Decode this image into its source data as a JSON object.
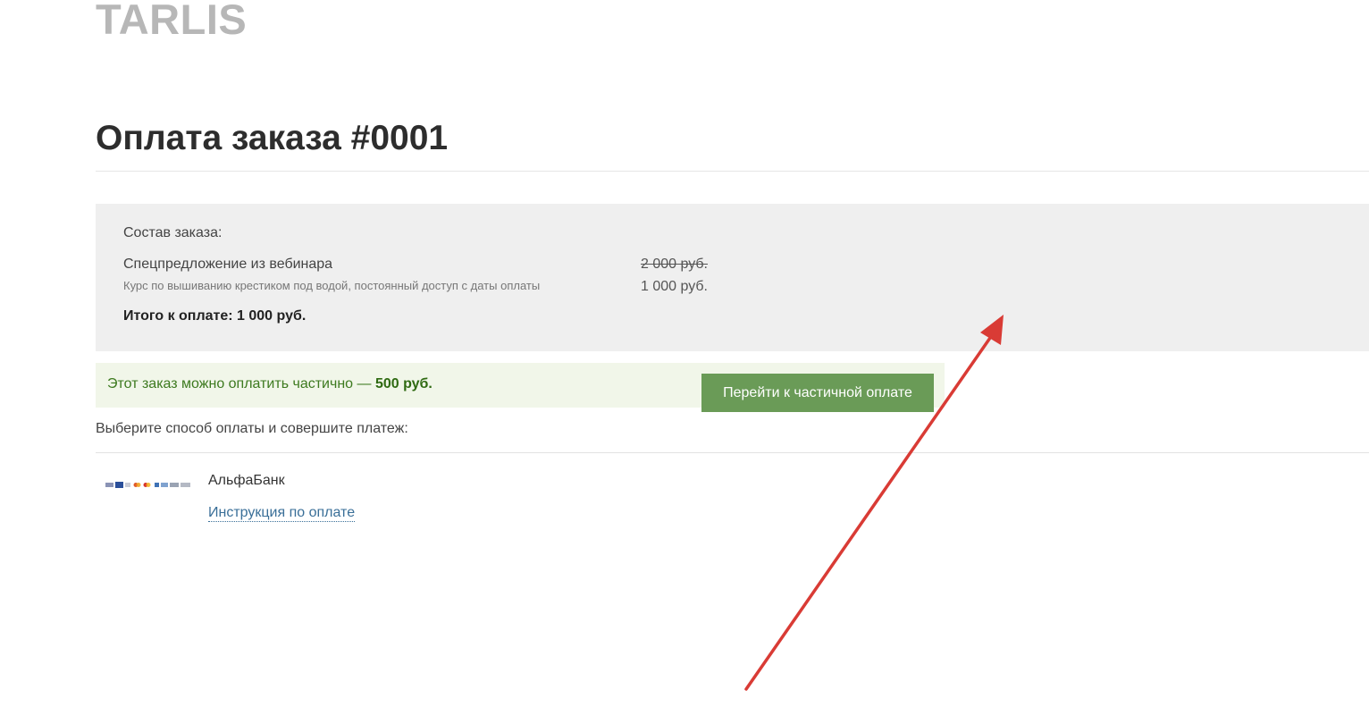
{
  "brand": {
    "logo_text": "TARLIS"
  },
  "page": {
    "title": "Оплата заказа #0001"
  },
  "order": {
    "heading": "Состав заказа:",
    "item": {
      "name": "Спецпредложение из вебинара",
      "description": "Курс по вышиванию крестиком под водой, постоянный доступ с даты оплаты",
      "old_price": "2 000 руб.",
      "price": "1 000 руб."
    },
    "total": "Итого к оплате: 1 000 руб."
  },
  "partial": {
    "text": "Этот заказ можно оплатить частично — ",
    "amount": "500 руб.",
    "button_label": "Перейти к частичной оплате"
  },
  "payment": {
    "prompt": "Выберите способ оплаты и совершите платеж:",
    "method": {
      "name": "АльфаБанк",
      "instruction_link": "Инструкция по оплате",
      "logos_icon": "payment-card-logos-icon"
    }
  },
  "annotation": {
    "arrow_color": "#d93b35"
  },
  "colors": {
    "panel_bg": "#efefef",
    "partial_bg": "#f1f6e9",
    "button_bg": "#6a9b57",
    "link": "#3a6f98"
  }
}
